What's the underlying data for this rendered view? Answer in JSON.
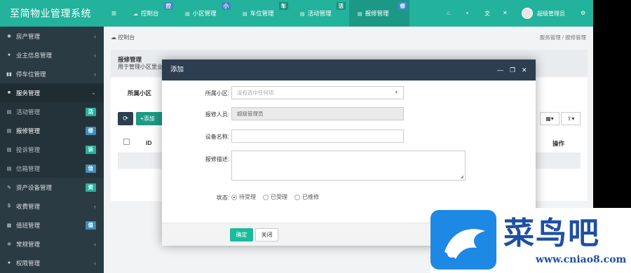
{
  "app": {
    "title": "至简物业管理系统"
  },
  "topbar": {
    "tabs": [
      {
        "label": "控制台",
        "badge": "控"
      },
      {
        "label": "小区管理",
        "badge": "小"
      },
      {
        "label": "车位管理",
        "badge": "车"
      },
      {
        "label": "活动管理",
        "badge": "活"
      },
      {
        "label": "报修管理",
        "badge": "修"
      }
    ],
    "user": "超级管理员",
    "icons": [
      "home-icon",
      "trash-icon",
      "lang-icon",
      "fullscreen-icon",
      "settings-icon"
    ]
  },
  "sidebar": {
    "items": [
      {
        "label": "房产管理",
        "arrow": "‹"
      },
      {
        "label": "业主信息管理",
        "arrow": "‹"
      },
      {
        "label": "停车位管理",
        "arrow": "‹"
      },
      {
        "label": "服务管理",
        "arrow": "⌄"
      },
      {
        "label": "活动管理",
        "badge": "活"
      },
      {
        "label": "报修管理",
        "badge": "修"
      },
      {
        "label": "投诉管理",
        "badge": "诉"
      },
      {
        "label": "信箱管理",
        "badge": "信"
      },
      {
        "label": "资产设备管理",
        "badge": "资"
      },
      {
        "label": "收费管理",
        "arrow": "‹"
      },
      {
        "label": "值班管理",
        "badge": "值"
      },
      {
        "label": "常规管理",
        "arrow": "‹"
      },
      {
        "label": "权限管理",
        "arrow": "‹"
      }
    ]
  },
  "content": {
    "breadcrumb": "控制台",
    "breadcrumb_right": "服务管理 / 报修管理",
    "header_title": "报修管理",
    "header_sub": "用于管理小区里业",
    "filter_label": "所属小区",
    "add_label": "添加",
    "th_id": "ID",
    "th_op": "操作"
  },
  "modal": {
    "title": "添加",
    "fields": {
      "community_label": "所属小区:",
      "community_placeholder": "没有选中任何项",
      "reporter_label": "报修人员:",
      "reporter_value": "超级管理员",
      "device_label": "设备名称:",
      "desc_label": "报修描述:",
      "status_label": "状态:"
    },
    "status_options": [
      "待受理",
      "已受理",
      "已维修"
    ],
    "status_selected": 0,
    "ok_label": "确定",
    "close_label": "关闭"
  },
  "watermark": {
    "text": "菜鸟吧",
    "url": "www.cniao8.com"
  }
}
